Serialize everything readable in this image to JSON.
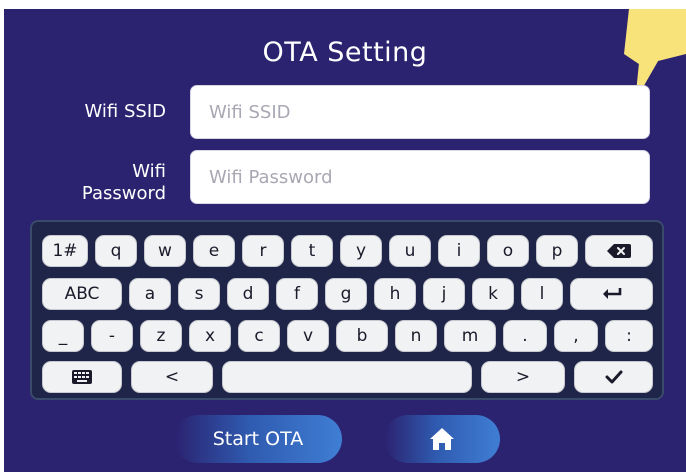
{
  "title": "OTA Setting",
  "fields": {
    "ssid": {
      "label": "Wifi SSID",
      "placeholder": "Wifi SSID",
      "value": ""
    },
    "password": {
      "label": "Wifi\nPassword",
      "placeholder": "Wifi Password",
      "value": ""
    }
  },
  "keyboard": {
    "row1": [
      "1#",
      "q",
      "w",
      "e",
      "r",
      "t",
      "y",
      "u",
      "i",
      "o",
      "p",
      "backspace"
    ],
    "row2": [
      "ABC",
      "a",
      "s",
      "d",
      "f",
      "g",
      "h",
      "j",
      "k",
      "l",
      "enter"
    ],
    "row3": [
      "_",
      "-",
      "z",
      "x",
      "c",
      "v",
      "b",
      "n",
      "m",
      ".",
      ",",
      ":"
    ],
    "row4": [
      "keyboard",
      "<",
      "space",
      ">",
      "check"
    ]
  },
  "buttons": {
    "start_ota": "Start OTA",
    "home_icon": "home-icon"
  },
  "colors": {
    "background": "#2b2270",
    "keyboard_bg": "#1f2548",
    "key_bg": "#f1f2f4",
    "accent_blob": "#f8e27a",
    "button_gradient_end": "#3f7ed4"
  }
}
